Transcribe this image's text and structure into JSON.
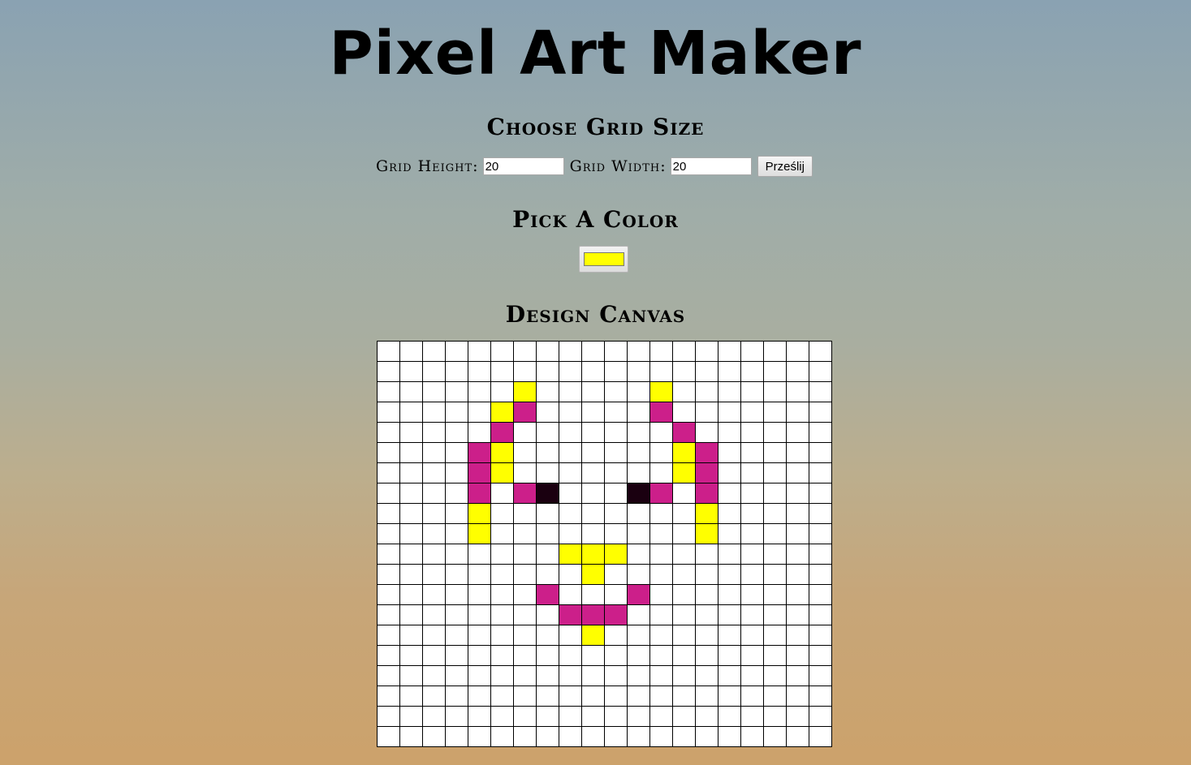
{
  "title": "Pixel Art Maker",
  "grid_section": {
    "heading": "Choose Grid Size",
    "height_label": "Grid Height:",
    "height_value": "20",
    "width_label": "Grid Width:",
    "width_value": "20",
    "submit_label": "Prześlij"
  },
  "color_section": {
    "heading": "Pick A Color",
    "selected_color": "#ffff00"
  },
  "canvas_section": {
    "heading": "Design Canvas",
    "rows": 20,
    "cols": 20,
    "colors": {
      "Y": "#ffff00",
      "M": "#cc1f8a",
      "D": "#1a0010"
    },
    "painted": [
      {
        "r": 2,
        "c": 6,
        "k": "Y"
      },
      {
        "r": 2,
        "c": 12,
        "k": "Y"
      },
      {
        "r": 3,
        "c": 5,
        "k": "Y"
      },
      {
        "r": 3,
        "c": 6,
        "k": "M"
      },
      {
        "r": 3,
        "c": 12,
        "k": "M"
      },
      {
        "r": 4,
        "c": 5,
        "k": "M"
      },
      {
        "r": 4,
        "c": 13,
        "k": "M"
      },
      {
        "r": 5,
        "c": 4,
        "k": "M"
      },
      {
        "r": 5,
        "c": 5,
        "k": "Y"
      },
      {
        "r": 5,
        "c": 13,
        "k": "Y"
      },
      {
        "r": 5,
        "c": 14,
        "k": "M"
      },
      {
        "r": 6,
        "c": 4,
        "k": "M"
      },
      {
        "r": 6,
        "c": 5,
        "k": "Y"
      },
      {
        "r": 6,
        "c": 13,
        "k": "Y"
      },
      {
        "r": 6,
        "c": 14,
        "k": "M"
      },
      {
        "r": 7,
        "c": 4,
        "k": "M"
      },
      {
        "r": 7,
        "c": 6,
        "k": "M"
      },
      {
        "r": 7,
        "c": 7,
        "k": "D"
      },
      {
        "r": 7,
        "c": 11,
        "k": "D"
      },
      {
        "r": 7,
        "c": 12,
        "k": "M"
      },
      {
        "r": 7,
        "c": 14,
        "k": "M"
      },
      {
        "r": 8,
        "c": 4,
        "k": "Y"
      },
      {
        "r": 8,
        "c": 14,
        "k": "Y"
      },
      {
        "r": 9,
        "c": 4,
        "k": "Y"
      },
      {
        "r": 9,
        "c": 14,
        "k": "Y"
      },
      {
        "r": 10,
        "c": 8,
        "k": "Y"
      },
      {
        "r": 10,
        "c": 9,
        "k": "Y"
      },
      {
        "r": 10,
        "c": 10,
        "k": "Y"
      },
      {
        "r": 11,
        "c": 9,
        "k": "Y"
      },
      {
        "r": 12,
        "c": 7,
        "k": "M"
      },
      {
        "r": 12,
        "c": 11,
        "k": "M"
      },
      {
        "r": 13,
        "c": 8,
        "k": "M"
      },
      {
        "r": 13,
        "c": 9,
        "k": "M"
      },
      {
        "r": 13,
        "c": 10,
        "k": "M"
      },
      {
        "r": 14,
        "c": 9,
        "k": "Y"
      }
    ]
  }
}
